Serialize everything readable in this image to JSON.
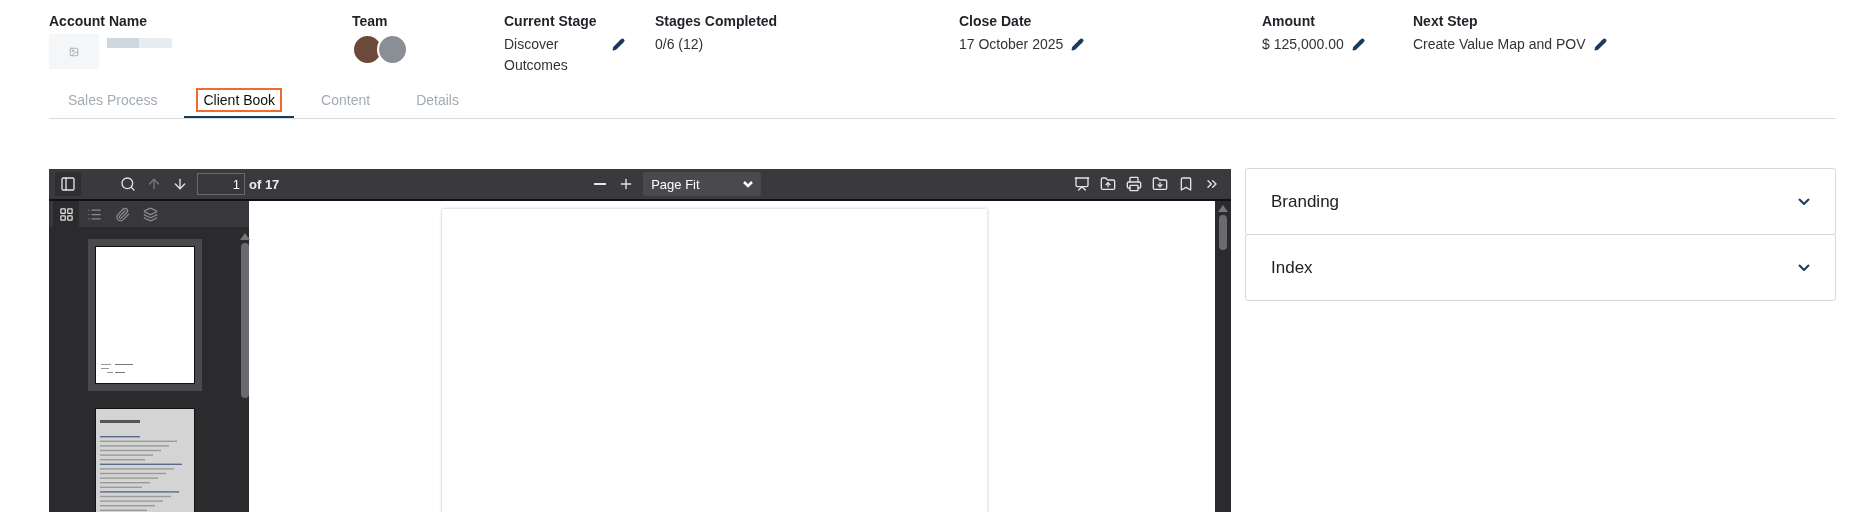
{
  "header": [
    {
      "kind": "account",
      "label": "Account Name"
    },
    {
      "kind": "team",
      "label": "Team"
    },
    {
      "kind": "stage",
      "label": "Current Stage",
      "value": "Discover Outcomes",
      "editable": true
    },
    {
      "kind": "text",
      "label": "Stages Completed",
      "value": "0/6 (12)",
      "editable": false
    },
    {
      "kind": "text",
      "label": "Close Date",
      "value": "17 October 2025",
      "editable": true
    },
    {
      "kind": "text",
      "label": "Amount",
      "value": "$ 125,000.00",
      "editable": true
    },
    {
      "kind": "text",
      "label": "Next Step",
      "value": "Create Value Map and POV",
      "editable": true
    }
  ],
  "tabs": [
    {
      "label": "Sales Process",
      "selected": false
    },
    {
      "label": "Client Book",
      "selected": true
    },
    {
      "label": "Content",
      "selected": false
    },
    {
      "label": "Details",
      "selected": false
    }
  ],
  "viewer": {
    "page_input": "1",
    "page_count": "of 17",
    "zoom": "Page Fit",
    "tools": [
      {
        "kind": "sidebar",
        "disabled": false
      },
      {
        "kind": "search",
        "disabled": false
      },
      {
        "kind": "up",
        "disabled": true
      },
      {
        "kind": "down",
        "disabled": false
      }
    ],
    "right_tools": [
      {
        "kind": "present"
      },
      {
        "kind": "open"
      },
      {
        "kind": "print"
      },
      {
        "kind": "save"
      },
      {
        "kind": "bookmark"
      },
      {
        "kind": "more"
      }
    ],
    "sidebar_tabs": [
      {
        "kind": "thumbnails",
        "selected": true
      },
      {
        "kind": "outline",
        "selected": false
      },
      {
        "kind": "attachments",
        "selected": false
      },
      {
        "kind": "layers",
        "selected": false
      }
    ],
    "thumbnails": [
      {
        "kind": "cover",
        "selected": true
      },
      {
        "kind": "contents",
        "selected": false
      }
    ]
  },
  "panels": [
    {
      "title": "Branding",
      "expanded": false
    },
    {
      "title": "Index",
      "expanded": false
    }
  ]
}
